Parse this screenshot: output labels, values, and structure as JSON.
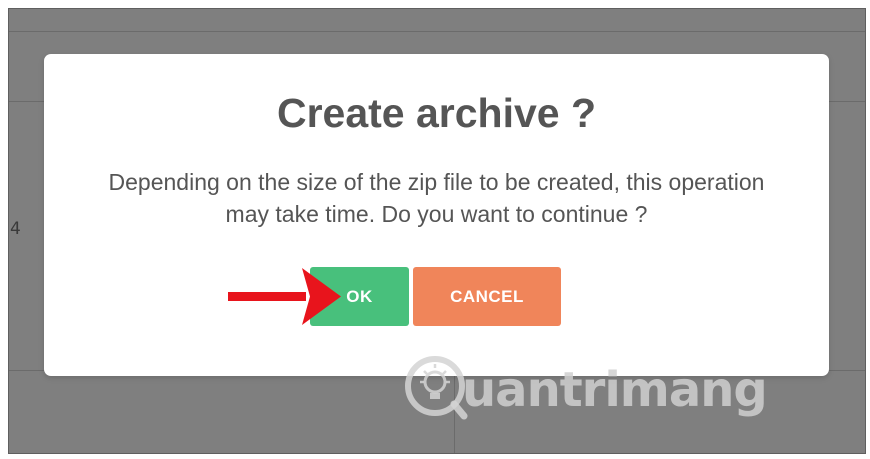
{
  "background": {
    "partial_text": "4"
  },
  "dialog": {
    "title": "Create archive ?",
    "message": "Depending on the size of the zip file to be created, this operation may take time. Do you want to continue ?",
    "ok_label": "OK",
    "cancel_label": "CANCEL"
  },
  "annotation": {
    "arrow_icon": "right-arrow-icon",
    "arrow_color": "#e8141c"
  },
  "watermark": {
    "text": "uantrimang",
    "icon": "lightbulb-q-logo"
  },
  "colors": {
    "ok": "#48c07c",
    "cancel": "#f0855a",
    "overlay": "#7f7f7f",
    "title_text": "#555555"
  }
}
